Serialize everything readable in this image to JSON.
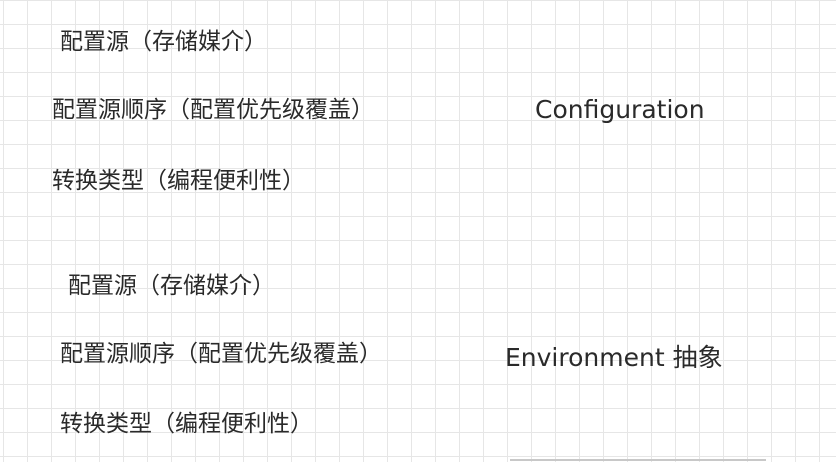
{
  "group1": {
    "items": [
      "配置源（存储媒介）",
      "配置源顺序（配置优先级覆盖）",
      "转换类型（编程便利性）"
    ],
    "title": "Configuration"
  },
  "group2": {
    "items": [
      "配置源（存储媒介）",
      "配置源顺序（配置优先级覆盖）",
      "转换类型（编程便利性）"
    ],
    "title": "Environment 抽象"
  }
}
